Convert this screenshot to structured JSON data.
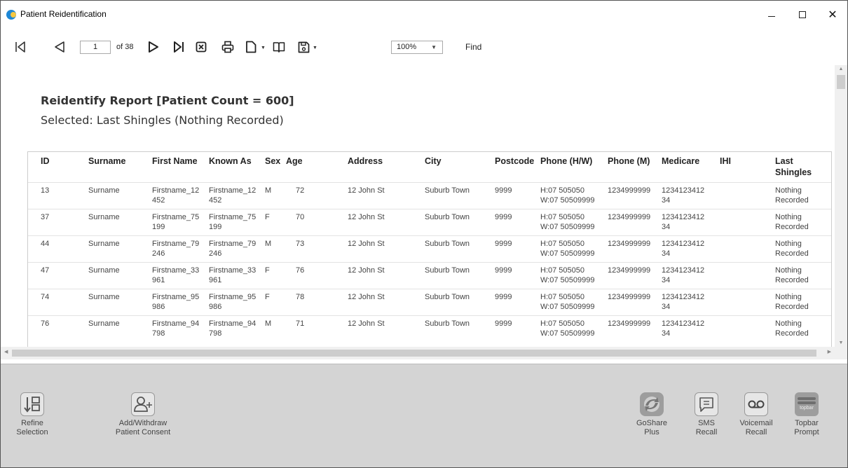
{
  "window": {
    "title": "Patient Reidentification"
  },
  "toolbar": {
    "current_page": "1",
    "page_of": "of 38",
    "zoom": "100%",
    "find_label": "Find"
  },
  "report": {
    "title": "Reidentify Report  [Patient Count = 600]",
    "subtitle": "Selected: Last Shingles (Nothing Recorded)",
    "columns": [
      "ID",
      "Surname",
      "First Name",
      "Known As",
      "Sex",
      "Age",
      "Address",
      "City",
      "Postcode",
      "Phone (H/W)",
      "Phone (M)",
      "Medicare",
      "IHI",
      "Last Shingles"
    ],
    "rows": [
      {
        "id": "13",
        "surname": "Surname",
        "first_name": "Firstname_12 452",
        "known_as": "Firstname_12 452",
        "sex": "M",
        "age": "72",
        "address": "12 John St",
        "city": "Suburb Town",
        "postcode": "9999",
        "phone_hw": "H:07 505050 W:07 50509999",
        "phone_m": "1234999999",
        "medicare": "1234123412 34",
        "ihi": "",
        "last_shingles": "Nothing Recorded"
      },
      {
        "id": "37",
        "surname": "Surname",
        "first_name": "Firstname_75 199",
        "known_as": "Firstname_75 199",
        "sex": "F",
        "age": "70",
        "address": "12 John St",
        "city": "Suburb Town",
        "postcode": "9999",
        "phone_hw": "H:07 505050 W:07 50509999",
        "phone_m": "1234999999",
        "medicare": "1234123412 34",
        "ihi": "",
        "last_shingles": "Nothing Recorded"
      },
      {
        "id": "44",
        "surname": "Surname",
        "first_name": "Firstname_79 246",
        "known_as": "Firstname_79 246",
        "sex": "M",
        "age": "73",
        "address": "12 John St",
        "city": "Suburb Town",
        "postcode": "9999",
        "phone_hw": "H:07 505050 W:07 50509999",
        "phone_m": "1234999999",
        "medicare": "1234123412 34",
        "ihi": "",
        "last_shingles": "Nothing Recorded"
      },
      {
        "id": "47",
        "surname": "Surname",
        "first_name": "Firstname_33 961",
        "known_as": "Firstname_33 961",
        "sex": "F",
        "age": "76",
        "address": "12 John St",
        "city": "Suburb Town",
        "postcode": "9999",
        "phone_hw": "H:07 505050 W:07 50509999",
        "phone_m": "1234999999",
        "medicare": "1234123412 34",
        "ihi": "",
        "last_shingles": "Nothing Recorded"
      },
      {
        "id": "74",
        "surname": "Surname",
        "first_name": "Firstname_95 986",
        "known_as": "Firstname_95 986",
        "sex": "F",
        "age": "78",
        "address": "12 John St",
        "city": "Suburb Town",
        "postcode": "9999",
        "phone_hw": "H:07 505050 W:07 50509999",
        "phone_m": "1234999999",
        "medicare": "1234123412 34",
        "ihi": "",
        "last_shingles": "Nothing Recorded"
      },
      {
        "id": "76",
        "surname": "Surname",
        "first_name": "Firstname_94 798",
        "known_as": "Firstname_94 798",
        "sex": "M",
        "age": "71",
        "address": "12 John St",
        "city": "Suburb Town",
        "postcode": "9999",
        "phone_hw": "H:07 505050 W:07 50509999",
        "phone_m": "1234999999",
        "medicare": "1234123412 34",
        "ihi": "",
        "last_shingles": "Nothing Recorded"
      }
    ]
  },
  "actions": {
    "refine_selection": "Refine Selection",
    "add_withdraw_consent": "Add/Withdraw Patient Consent",
    "goshare_plus": "GoShare Plus",
    "sms_recall": "SMS Recall",
    "voicemail_recall": "Voicemail Recall",
    "topbar_prompt": "Topbar Prompt",
    "topbar_logo_text": "topbar"
  },
  "icons": {
    "first_page": "first-page-icon",
    "prev_page": "prev-page-icon",
    "next_page": "next-page-icon",
    "last_page": "last-page-icon",
    "stop": "stop-icon",
    "print": "print-icon",
    "page_setup": "page-setup-icon",
    "book": "book-icon",
    "save": "save-icon"
  },
  "colors": {
    "panel_bg": "#d4d4d4",
    "app_icon_blue": "#1e88d6",
    "app_icon_yellow": "#f7c843"
  }
}
